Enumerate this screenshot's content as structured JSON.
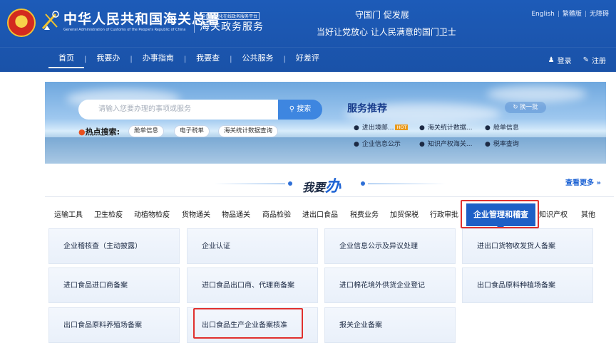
{
  "header": {
    "org_name": "中华人民共和国海关总署",
    "org_en": "General Administration of Customs of the People's Republic of China",
    "platform_small": "全国一体化在线政务服务平台",
    "platform_name": "海关政务服务",
    "slogan1": "守国门  促发展",
    "slogan2": "当好让党放心  让人民满意的国门卫士",
    "top_links": [
      "English",
      "繁體版",
      "无障碍"
    ]
  },
  "nav": {
    "items": [
      "首页",
      "我要办",
      "办事指南",
      "我要查",
      "公共服务",
      "好差评"
    ],
    "login": "登录",
    "register": "注册"
  },
  "banner": {
    "search_placeholder": "请输入您要办理的事项或服务",
    "search_button": "搜索",
    "hot_label": "热点搜索:",
    "hot_tags": [
      "舱单信息",
      "电子税单",
      "海关统计数据查询"
    ],
    "service_title": "服务推荐",
    "refresh_label": "换一批",
    "hot_badge": "HOT",
    "services": [
      "进出境邮...",
      "海关统计数据...",
      "舱单信息",
      "企业信息公示",
      "知识产权海关...",
      "税率查询"
    ]
  },
  "section": {
    "title_prefix": "我要",
    "title_big": "办",
    "see_more": "查看更多 »"
  },
  "tabs": {
    "items": [
      "运输工具",
      "卫生检疫",
      "动植物检疫",
      "货物通关",
      "物品通关",
      "商品检验",
      "进出口食品",
      "税费业务",
      "加贸保税",
      "行政审批",
      "知识产权",
      "其他"
    ],
    "active": "企业管理和稽查"
  },
  "cards": [
    "企业稽核查（主动披露）",
    "企业认证",
    "企业信息公示及异议处理",
    "进出口货物收发货人备案",
    "进口食品进口商备案",
    "进口食品出口商、代理商备案",
    "进口棉花境外供货企业登记",
    "出口食品原料种植场备案",
    "出口食品原料养殖场备案",
    "出口食品生产企业备案核准",
    "报关企业备案"
  ],
  "colors": {
    "header_blue": "#1d5bb8",
    "accent_blue": "#1e5fc6",
    "highlight_red": "#e0302e",
    "hot_orange": "#e99a1e"
  }
}
